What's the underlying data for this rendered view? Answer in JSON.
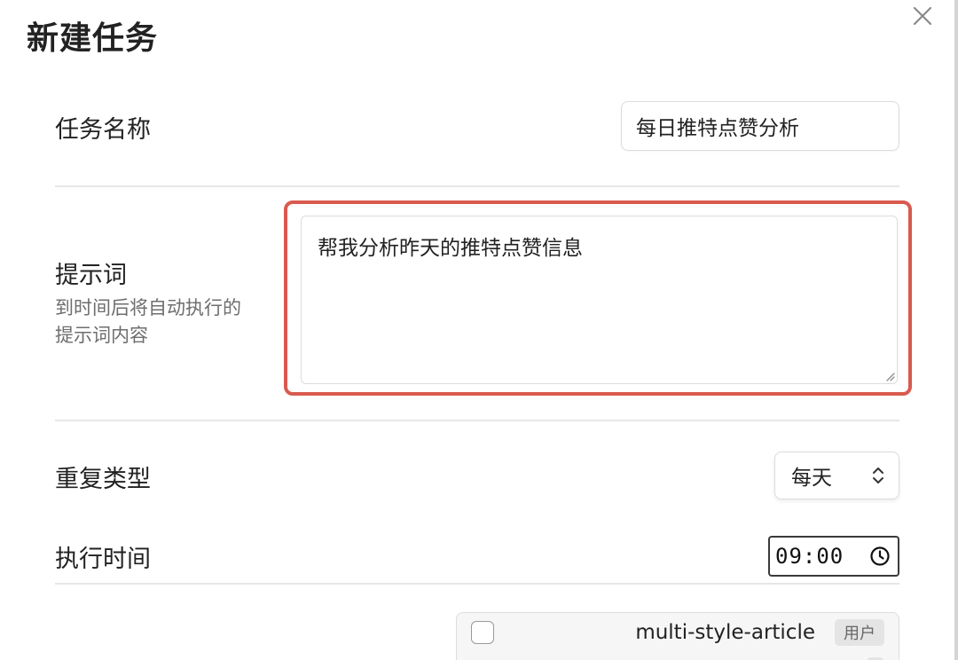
{
  "dialog": {
    "title": "新建任务",
    "close_icon": "close-icon"
  },
  "form": {
    "task_name": {
      "label": "任务名称",
      "value": "每日推特点赞分析"
    },
    "prompt": {
      "label": "提示词",
      "description_line1": "到时间后将自动执行的",
      "description_line2": "提示词内容",
      "value": "帮我分析昨天的推特点赞信息",
      "highlight_color": "#d95a4f"
    },
    "repeat_type": {
      "label": "重复类型",
      "selected": "每天",
      "icon": "chevron-up-down-icon"
    },
    "exec_time": {
      "label": "执行时间",
      "value": "09:00",
      "icon": "clock-icon"
    },
    "skills": {
      "items": [
        {
          "name": "multi-style-article",
          "tag": "用户",
          "checked": false
        }
      ]
    }
  }
}
